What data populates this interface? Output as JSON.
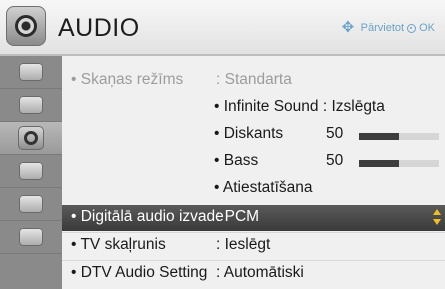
{
  "header": {
    "title": "AUDIO",
    "hint_move": "Pārvietot",
    "hint_ok": "OK"
  },
  "sidebar": {
    "items": [
      "picture",
      "display",
      "audio",
      "clock",
      "lock",
      "option"
    ],
    "active_index": 2
  },
  "menu": {
    "sound_mode": {
      "label": "• Skaņas režīms",
      "value": ": Standarta"
    },
    "infinite_sound": {
      "text": "• Infinite Sound : Izslēgta"
    },
    "treble": {
      "label": "• Diskants",
      "value": "50",
      "level_fraction": 0.5
    },
    "bass": {
      "label": "• Bass",
      "value": "50",
      "level_fraction": 0.5
    },
    "reset": {
      "label": "• Atiestatīšana"
    },
    "digital_audio_out": {
      "label": "• Digitālā audio izvade",
      "value": ": PCM"
    },
    "tv_speaker": {
      "label": "• TV skaļrunis",
      "value": ": Ieslēgt"
    },
    "dtv_audio": {
      "label": "• DTV Audio Setting",
      "value": ": Automātiski"
    }
  },
  "colors": {
    "highlight": "#4a4a4a",
    "accent": "#f0c020",
    "hint": "#6aa3c9",
    "disabled_text": "#9c9c9c"
  }
}
